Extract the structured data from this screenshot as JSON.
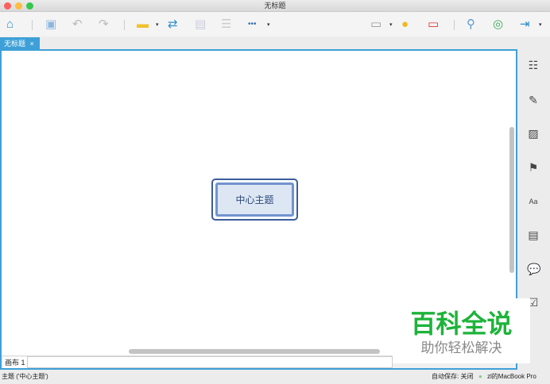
{
  "window": {
    "title": "无标题"
  },
  "tab": {
    "label": "无标题",
    "close": "×"
  },
  "topic": {
    "label": "中心主题"
  },
  "sheet": {
    "label": "画布 1"
  },
  "status": {
    "left": "主题 ('中心主题')",
    "autosave": "自动保存: 关闭",
    "device": "zl的MacBook Pro"
  },
  "watermark": {
    "title": "百科全说",
    "subtitle": "助你轻松解决"
  },
  "toolbar": {
    "more": "•••",
    "caret": "▾"
  }
}
